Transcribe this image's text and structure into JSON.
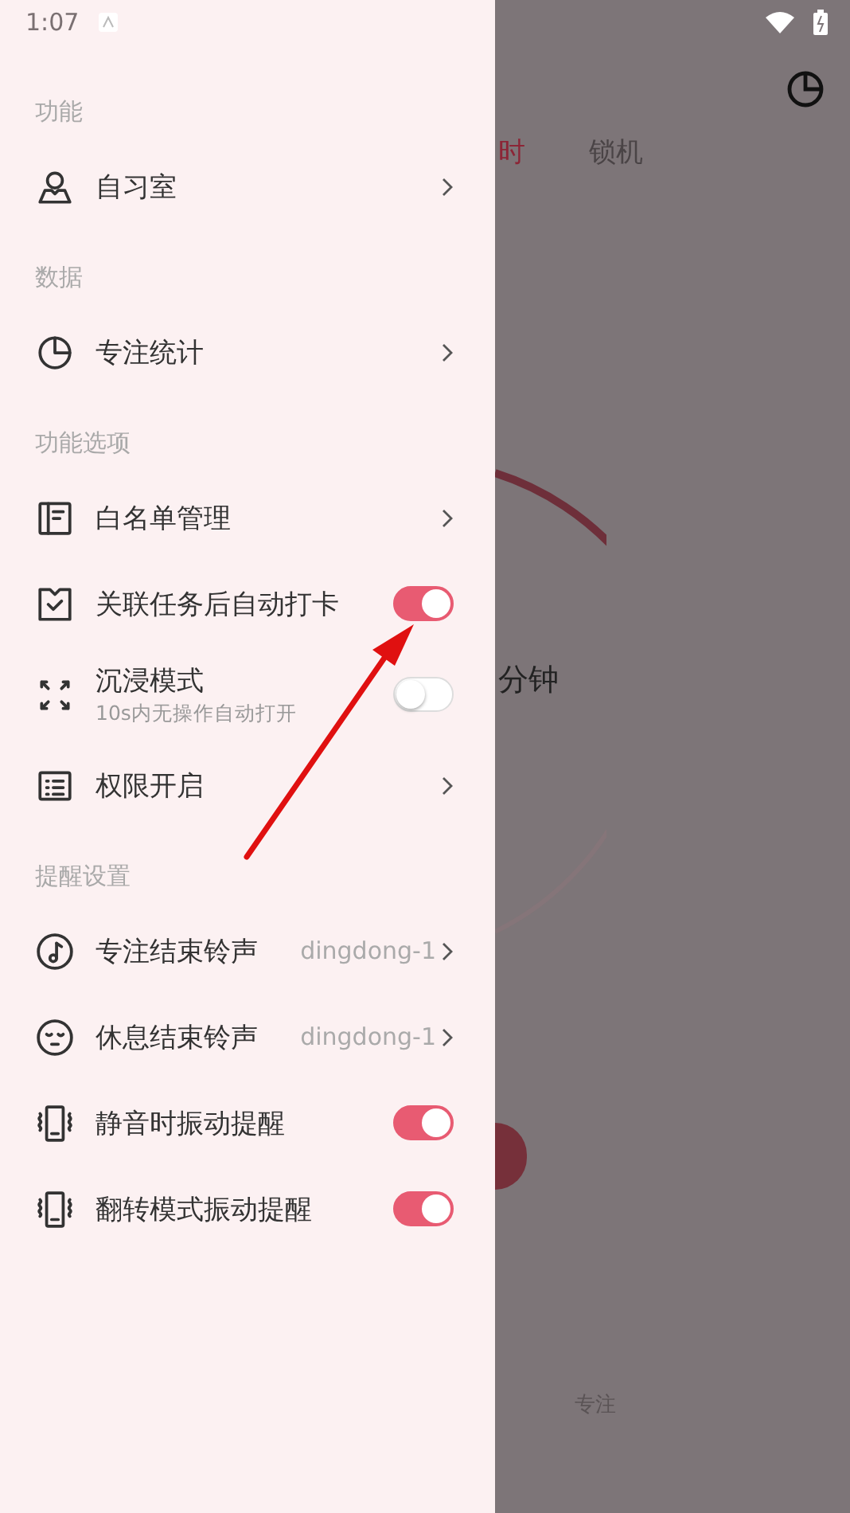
{
  "status_bar": {
    "time": "1:07"
  },
  "drawer": {
    "sections": [
      {
        "title": "功能",
        "items": [
          {
            "kind": "link",
            "label": "自习室"
          }
        ]
      },
      {
        "title": "数据",
        "items": [
          {
            "kind": "link",
            "label": "专注统计"
          }
        ]
      },
      {
        "title": "功能选项",
        "items": [
          {
            "kind": "link",
            "label": "白名单管理"
          },
          {
            "kind": "toggle",
            "label": "关联任务后自动打卡",
            "on": true
          },
          {
            "kind": "toggle",
            "label": "沉浸模式",
            "subtitle": "10s内无操作自动打开",
            "on": false
          },
          {
            "kind": "link",
            "label": "权限开启"
          }
        ]
      },
      {
        "title": "提醒设置",
        "items": [
          {
            "kind": "value",
            "label": "专注结束铃声",
            "value": "dingdong-1"
          },
          {
            "kind": "value",
            "label": "休息结束铃声",
            "value": "dingdong-1"
          },
          {
            "kind": "toggle",
            "label": "静音时振动提醒",
            "on": true
          },
          {
            "kind": "toggle",
            "label": "翻转模式振动提醒",
            "on": true
          }
        ]
      }
    ]
  },
  "background": {
    "tabs": [
      {
        "label": "时",
        "selected": true
      },
      {
        "label": "锁机",
        "selected": false
      }
    ],
    "timer_unit": "分钟",
    "nav_label": "专注"
  }
}
